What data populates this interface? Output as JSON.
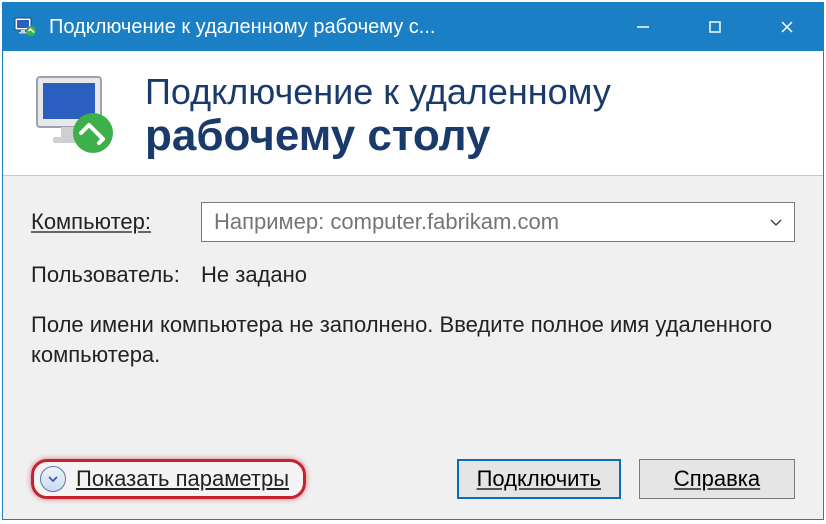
{
  "titlebar": {
    "title": "Подключение к удаленному рабочему с..."
  },
  "header": {
    "line1": "Подключение к удаленному",
    "line2": "рабочему столу"
  },
  "form": {
    "computer_label": "Компьютер:",
    "computer_placeholder": "Например: computer.fabrikam.com",
    "computer_value": "",
    "user_label": "Пользователь:",
    "user_value": "Не задано",
    "help_text": "Поле имени компьютера не заполнено. Введите полное имя удаленного компьютера."
  },
  "footer": {
    "show_options": "Показать параметры",
    "connect": "Подключить",
    "help": "Справка"
  }
}
